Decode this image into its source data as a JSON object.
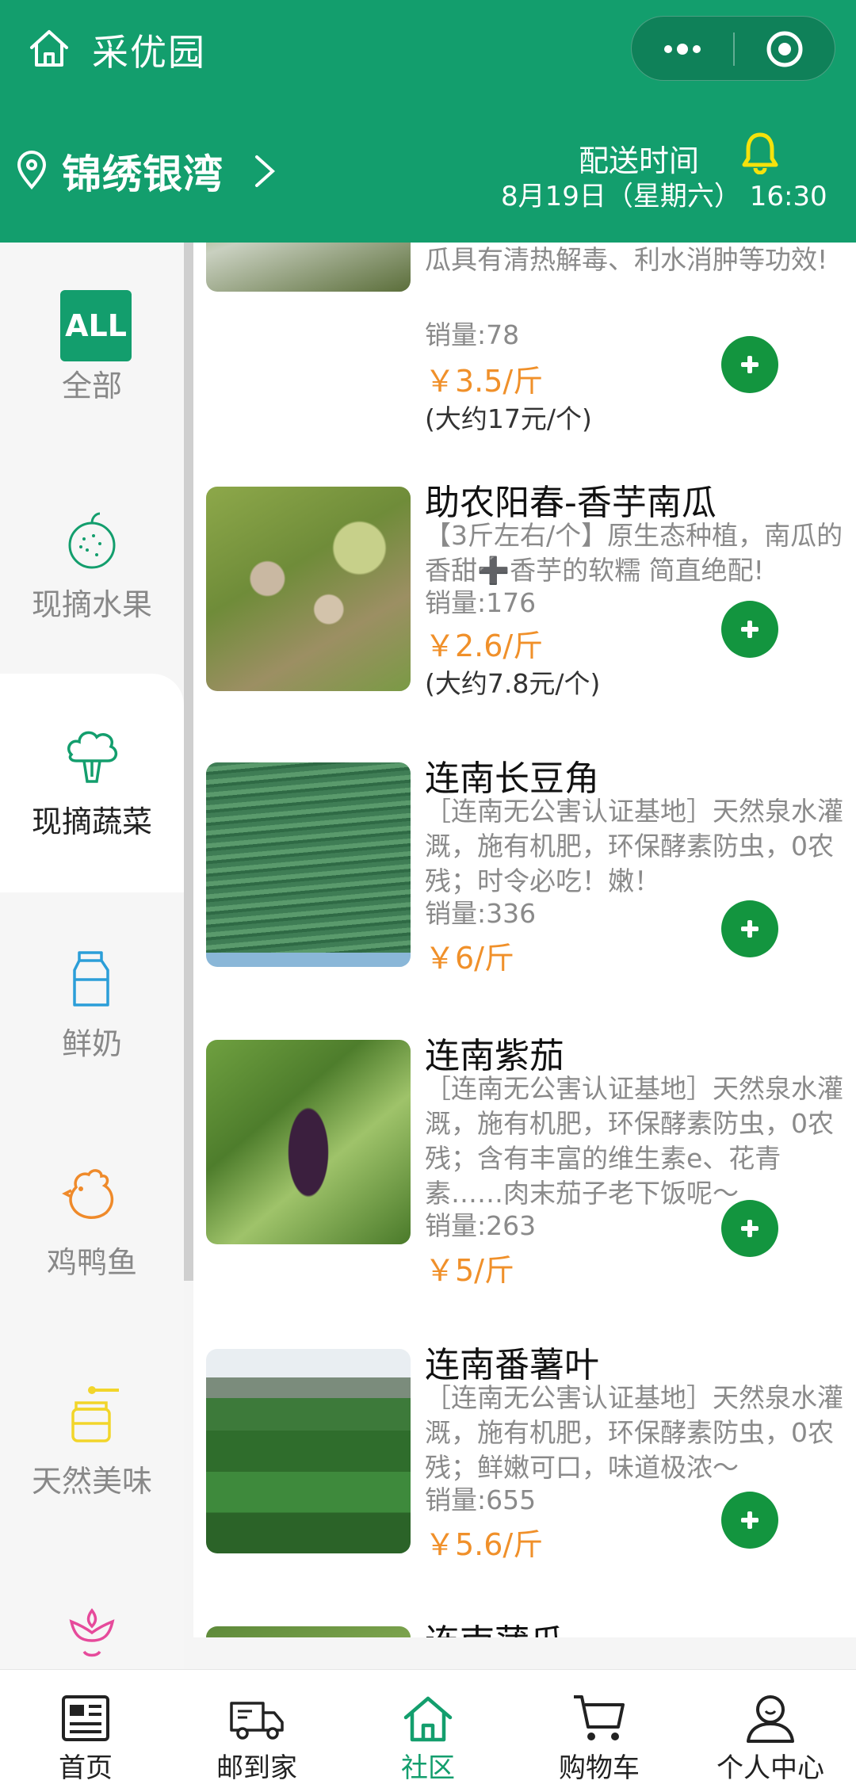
{
  "header": {
    "app_title": "采优园",
    "location": "锦绣银湾",
    "delivery_label": "配送时间",
    "delivery_time": "8月19日（星期六） 16:30"
  },
  "sidebar": {
    "items": [
      {
        "label": "全部",
        "icon": "all-badge",
        "badge": "ALL"
      },
      {
        "label": "现摘水果",
        "icon": "melon-icon"
      },
      {
        "label": "现摘蔬菜",
        "icon": "broccoli-icon",
        "active": true
      },
      {
        "label": "鲜奶",
        "icon": "milk-carton-icon"
      },
      {
        "label": "鸡鸭鱼",
        "icon": "rooster-icon"
      },
      {
        "label": "天然美味",
        "icon": "honey-jar-icon"
      },
      {
        "label": "",
        "icon": "flower-icon"
      }
    ]
  },
  "products": [
    {
      "desc": "瓜具有清热解毒、利水消肿等功效!",
      "sales": "销量:78",
      "price": "￥3.5/斤",
      "note": "(大约17元/个)"
    },
    {
      "name": "助农阳春-香芋南瓜",
      "desc": "【3斤左右/个】原生态种植，南瓜的香甜➕香芋的软糯 简直绝配!",
      "sales": "销量:176",
      "price": "￥2.6/斤",
      "note": "(大约7.8元/个)"
    },
    {
      "name": "连南长豆角",
      "desc": "［连南无公害认证基地］天然泉水灌溉，施有机肥，环保酵素防虫，0农残；时令必吃！嫩！",
      "sales": "销量:336",
      "price": "￥6/斤"
    },
    {
      "name": "连南紫茄",
      "desc": "［连南无公害认证基地］天然泉水灌溉，施有机肥，环保酵素防虫，0农残；含有丰富的维生素e、花青素……肉末茄子老下饭呢～",
      "sales": "销量:263",
      "price": "￥5/斤"
    },
    {
      "name": "连南番薯叶",
      "desc": "［连南无公害认证基地］天然泉水灌溉，施有机肥，环保酵素防虫，0农残；鲜嫩可口，味道极浓～",
      "sales": "销量:655",
      "price": "￥5.6/斤"
    },
    {
      "name": "连南蒲瓜"
    }
  ],
  "tabbar": {
    "items": [
      {
        "label": "首页",
        "icon": "newspaper-icon"
      },
      {
        "label": "邮到家",
        "icon": "delivery-truck-icon"
      },
      {
        "label": "社区",
        "icon": "home-icon",
        "active": true
      },
      {
        "label": "购物车",
        "icon": "cart-icon"
      },
      {
        "label": "个人中心",
        "icon": "person-icon"
      }
    ]
  },
  "colors": {
    "brand_green": "#139e6d",
    "add_button_green": "#13953f",
    "price_orange": "#f0902a"
  }
}
